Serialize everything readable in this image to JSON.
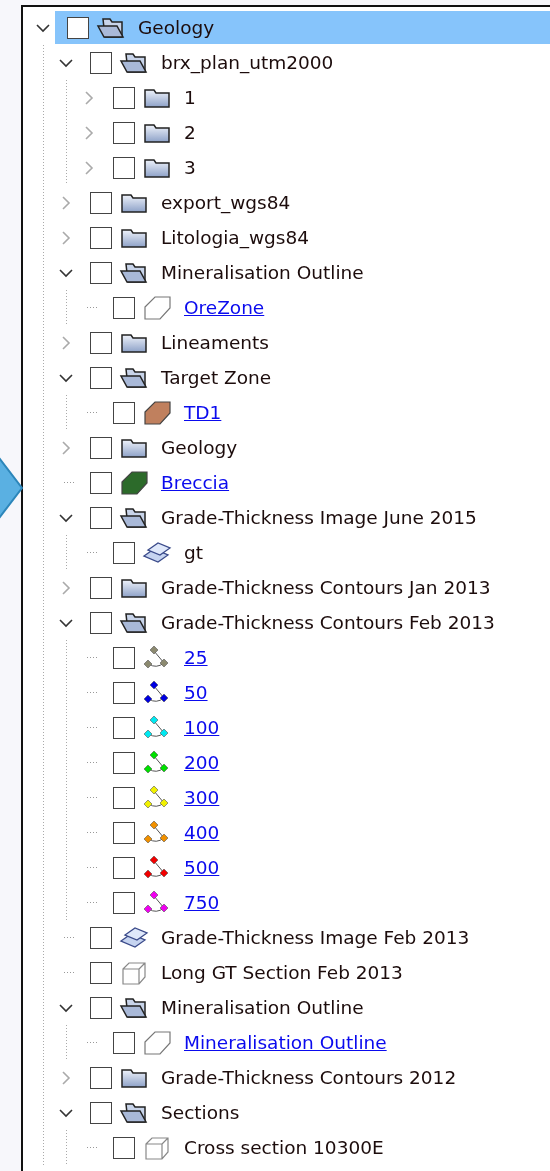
{
  "tree": [
    {
      "label": "Geology",
      "kind": "folder",
      "expanded": true,
      "checked": false,
      "selected": true,
      "link": false,
      "children": [
        {
          "label": "brx_plan_utm2000",
          "kind": "folder",
          "expanded": true,
          "checked": false,
          "selected": false,
          "link": false,
          "children": [
            {
              "label": "1",
              "kind": "folder",
              "expanded": false,
              "checked": false,
              "selected": false,
              "link": false
            },
            {
              "label": "2",
              "kind": "folder",
              "expanded": false,
              "checked": false,
              "selected": false,
              "link": false
            },
            {
              "label": "3",
              "kind": "folder",
              "expanded": false,
              "checked": false,
              "selected": false,
              "link": false
            }
          ]
        },
        {
          "label": "export_wgs84",
          "kind": "folder",
          "expanded": false,
          "checked": false,
          "selected": false,
          "link": false
        },
        {
          "label": "Litologia_wgs84",
          "kind": "folder",
          "expanded": false,
          "checked": false,
          "selected": false,
          "link": false
        },
        {
          "label": "Mineralisation Outline",
          "kind": "folder",
          "expanded": true,
          "checked": false,
          "selected": false,
          "link": false,
          "children": [
            {
              "label": "OreZone",
              "kind": "polygon",
              "checked": false,
              "selected": false,
              "link": true
            }
          ]
        },
        {
          "label": "Lineaments",
          "kind": "folder",
          "expanded": false,
          "checked": false,
          "selected": false,
          "link": false
        },
        {
          "label": "Target Zone",
          "kind": "folder",
          "expanded": true,
          "checked": false,
          "selected": false,
          "link": false,
          "children": [
            {
              "label": "TD1",
              "kind": "polygon",
              "color": "#c0805e",
              "checked": false,
              "selected": false,
              "link": true
            }
          ]
        },
        {
          "label": "Geology",
          "kind": "folder",
          "expanded": false,
          "checked": false,
          "selected": false,
          "link": false
        },
        {
          "label": "Breccia",
          "kind": "polygon",
          "color": "#2c6a2a",
          "checked": false,
          "selected": false,
          "link": true
        },
        {
          "label": "Grade-Thickness Image June 2015",
          "kind": "folder",
          "expanded": true,
          "checked": false,
          "selected": false,
          "link": false,
          "children": [
            {
              "label": "gt",
              "kind": "image",
              "checked": false,
              "selected": false,
              "link": false
            }
          ]
        },
        {
          "label": "Grade-Thickness Contours Jan 2013",
          "kind": "folder",
          "expanded": false,
          "checked": false,
          "selected": false,
          "link": false
        },
        {
          "label": "Grade-Thickness Contours Feb 2013",
          "kind": "folder",
          "expanded": true,
          "checked": false,
          "selected": false,
          "link": false,
          "children": [
            {
              "label": "25",
              "kind": "points",
              "color": "#8c8a70",
              "checked": false,
              "selected": false,
              "link": true
            },
            {
              "label": "50",
              "kind": "points",
              "color": "#0000e0",
              "checked": false,
              "selected": false,
              "link": true
            },
            {
              "label": "100",
              "kind": "points",
              "color": "#00e8f0",
              "checked": false,
              "selected": false,
              "link": true
            },
            {
              "label": "200",
              "kind": "points",
              "color": "#00e000",
              "checked": false,
              "selected": false,
              "link": true
            },
            {
              "label": "300",
              "kind": "points",
              "color": "#f0f000",
              "checked": false,
              "selected": false,
              "link": true
            },
            {
              "label": "400",
              "kind": "points",
              "color": "#f09000",
              "checked": false,
              "selected": false,
              "link": true
            },
            {
              "label": "500",
              "kind": "points",
              "color": "#f00000",
              "checked": false,
              "selected": false,
              "link": true
            },
            {
              "label": "750",
              "kind": "points",
              "color": "#f000f0",
              "checked": false,
              "selected": false,
              "link": true
            }
          ]
        },
        {
          "label": "Grade-Thickness Image Feb 2013",
          "kind": "image",
          "checked": false,
          "selected": false,
          "link": false
        },
        {
          "label": "Long GT Section Feb 2013",
          "kind": "section",
          "checked": false,
          "selected": false,
          "link": false
        },
        {
          "label": "Mineralisation Outline",
          "kind": "folder",
          "expanded": true,
          "checked": false,
          "selected": false,
          "link": false,
          "children": [
            {
              "label": "Mineralisation Outline",
              "kind": "polygon",
              "checked": false,
              "selected": false,
              "link": true
            }
          ]
        },
        {
          "label": "Grade-Thickness Contours 2012",
          "kind": "folder",
          "expanded": false,
          "checked": false,
          "selected": false,
          "link": false
        },
        {
          "label": "Sections",
          "kind": "folder",
          "expanded": true,
          "checked": false,
          "selected": false,
          "link": false,
          "children": [
            {
              "label": "Cross section 10300E",
              "kind": "section",
              "checked": false,
              "selected": false,
              "link": false
            }
          ]
        }
      ]
    }
  ]
}
